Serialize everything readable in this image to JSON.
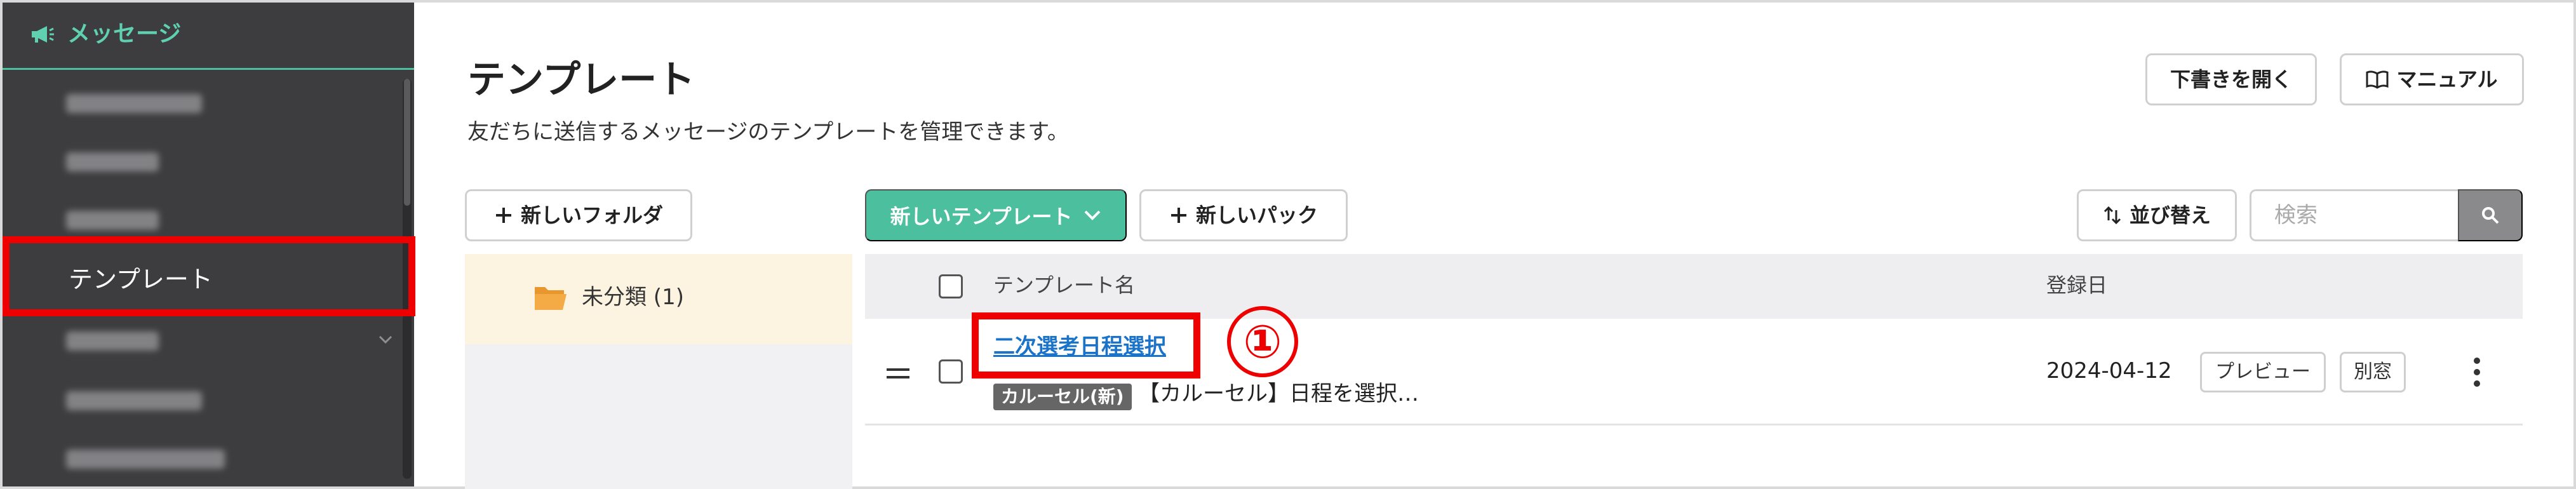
{
  "sidebar": {
    "header_label": "メッセージ",
    "active_item": "テンプレート",
    "colors": {
      "background": "#3d3d3f",
      "accent": "#5fd1b0"
    }
  },
  "header": {
    "title": "テンプレート",
    "description": "友だちに送信するメッセージのテンプレートを管理できます。",
    "open_draft_label": "下書きを開く",
    "manual_label": "マニュアル"
  },
  "toolbar": {
    "new_folder_label": "新しいフォルダ",
    "new_template_label": "新しいテンプレート",
    "new_pack_label": "新しいパック",
    "sort_label": "並び替え",
    "search_placeholder": "検索"
  },
  "folders": [
    {
      "name": "未分類 (1)"
    }
  ],
  "table": {
    "columns": {
      "name": "テンプレート名",
      "date": "登録日"
    },
    "rows": [
      {
        "name": "二次選考日程選択",
        "badge": "カルーセル(新)",
        "preview": "【カルーセル】日程を選択…",
        "date": "2024-04-12",
        "preview_button": "プレビュー",
        "window_button": "別窓"
      }
    ]
  },
  "annotation": {
    "marker": "①",
    "color": "#ee0000"
  },
  "colors": {
    "primary": "#4bbf9e",
    "link": "#1a72c9",
    "folder_selected_bg": "#fdf3e1"
  }
}
